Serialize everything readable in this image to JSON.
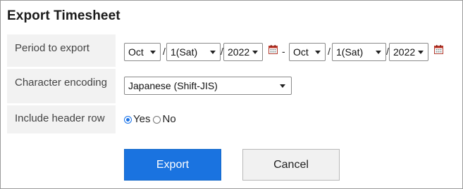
{
  "dialog": {
    "title": "Export Timesheet"
  },
  "form": {
    "period": {
      "label": "Period to export",
      "start": {
        "month": "Oct",
        "day": "1(Sat)",
        "year": "2022"
      },
      "range_separator": "-",
      "end": {
        "month": "Oct",
        "day": "1(Sat)",
        "year": "2022"
      },
      "date_separator": "/"
    },
    "encoding": {
      "label": "Character encoding",
      "value": "Japanese (Shift-JIS)"
    },
    "header_row": {
      "label": "Include header row",
      "yes_label": "Yes",
      "no_label": "No",
      "selected": "Yes"
    }
  },
  "actions": {
    "export_label": "Export",
    "cancel_label": "Cancel"
  },
  "colors": {
    "accent": "#1a73e0",
    "label_bg": "#f2f2f2",
    "calendar_icon": "#c0392b"
  },
  "icons": {
    "calendar": "calendar-icon",
    "dropdown": "chevron-down-icon"
  }
}
